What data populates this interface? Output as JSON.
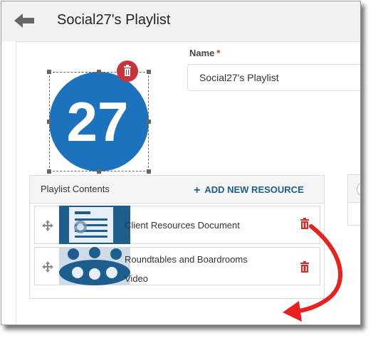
{
  "header": {
    "title": "Social27's Playlist",
    "back_icon": "arrow-left-icon"
  },
  "form": {
    "name_label": "Name",
    "required_marker": "*",
    "name_value": "Social27's Playlist"
  },
  "logo": {
    "text": "27",
    "circle_color": "#1c72bd",
    "delete_icon": "trash-icon"
  },
  "playlist": {
    "title": "Playlist Contents",
    "add_plus": "+",
    "add_label": "ADD NEW RESOURCE",
    "items": [
      {
        "line1": "Client Resources Document",
        "line2": "",
        "thumb_icon": "document-icon"
      },
      {
        "line1": "Roundtables and Boardrooms",
        "line2": "Video",
        "thumb_icon": "people-group-icon"
      }
    ]
  },
  "colors": {
    "accent": "#1e5e8f",
    "delete_red": "#d32f2f",
    "annotation_arrow": "#e8201e"
  }
}
